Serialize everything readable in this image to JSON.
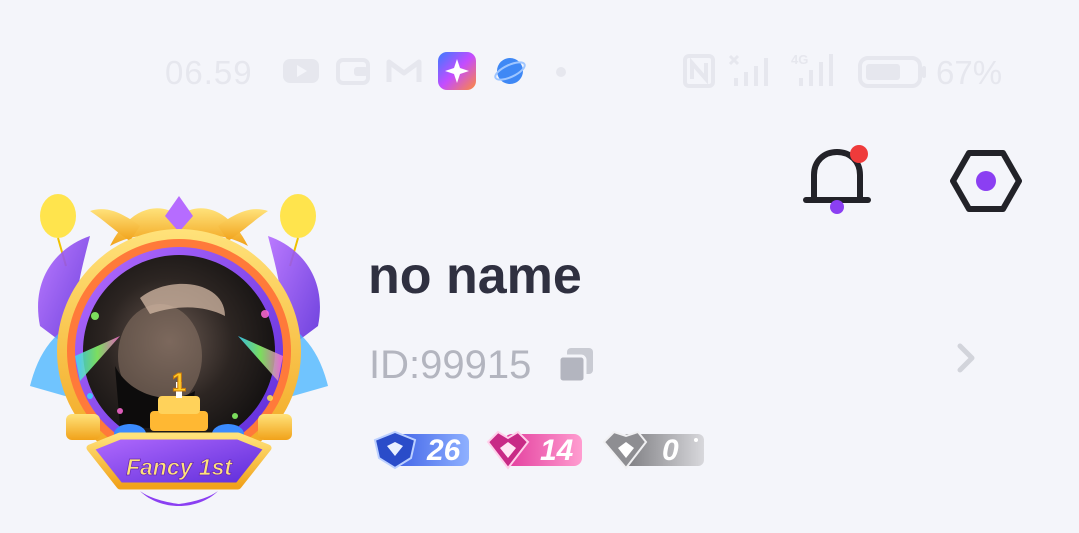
{
  "status_bar": {
    "time": "06.59",
    "battery_percent": "67%",
    "left_icons": [
      "youtube-icon",
      "wallet-icon",
      "gmail-icon",
      "app-star-icon",
      "browser-globe-icon",
      "dot-icon"
    ],
    "right_icons": [
      "nfc-icon",
      "signal-x-icon",
      "signal-4g-icon",
      "battery-icon"
    ]
  },
  "header": {
    "notification_icon": "bell-icon",
    "notification_dot_color": "#ef3b3b",
    "settings_icon": "hexagon-settings-icon",
    "accent_color": "#8b3ff2"
  },
  "profile": {
    "name": "no name",
    "id_text": "ID:99915",
    "frame_banner": "Fancy 1st",
    "frame_cake_number": "1"
  },
  "badges": [
    {
      "name": "blue-shield-badge",
      "value": "26",
      "color": "#4a78f0"
    },
    {
      "name": "pink-heart-badge",
      "value": "14",
      "color": "#e85aa8"
    },
    {
      "name": "silver-badge",
      "value": "0",
      "color": "#9a9a9e"
    }
  ]
}
